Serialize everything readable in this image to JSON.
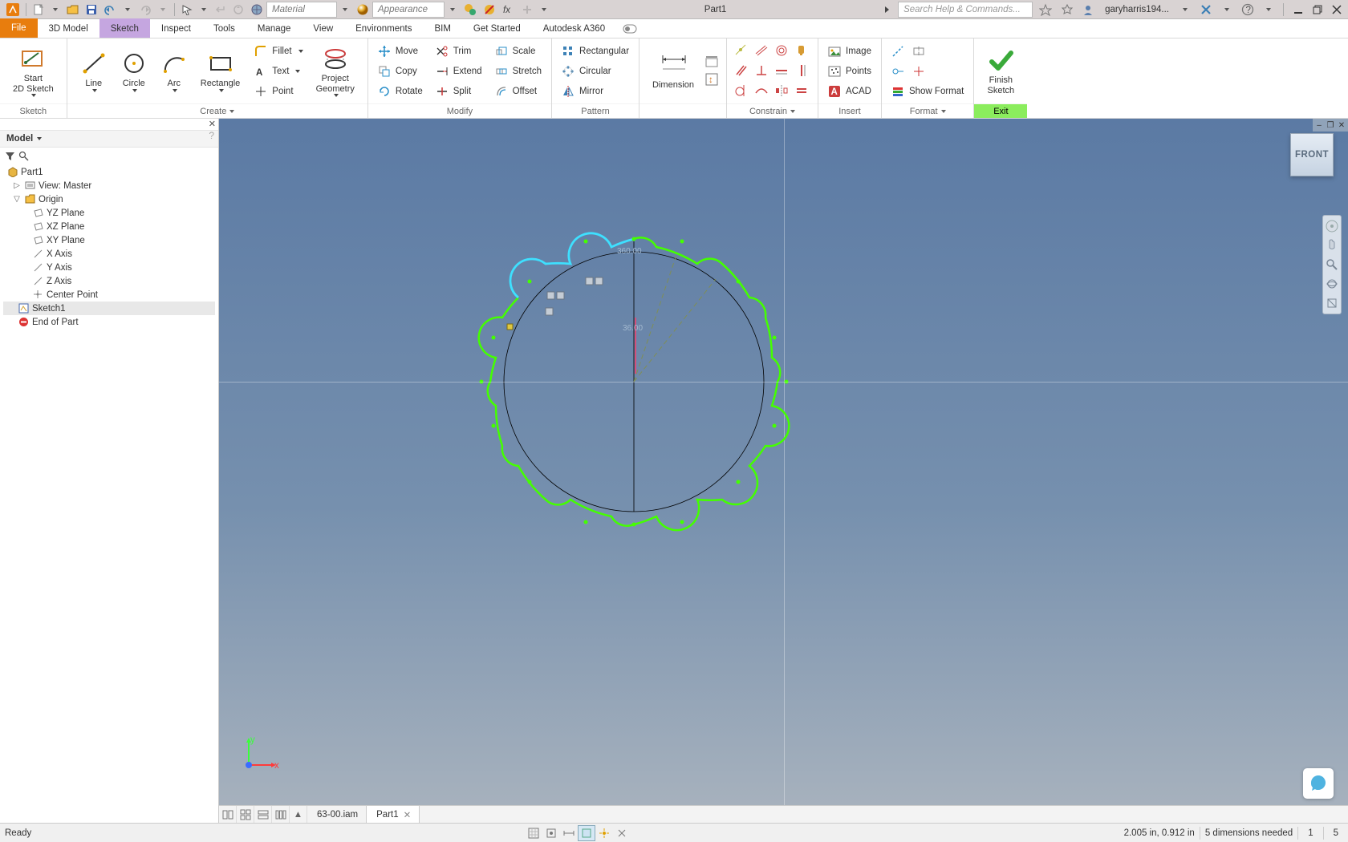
{
  "qat": {
    "material_label": "Material",
    "appearance_label": "Appearance",
    "doc_title": "Part1",
    "search_placeholder": "Search Help & Commands...",
    "username": "garyharris194..."
  },
  "tabs": {
    "file": "File",
    "items": [
      "3D Model",
      "Sketch",
      "Inspect",
      "Tools",
      "Manage",
      "View",
      "Environments",
      "BIM",
      "Get Started",
      "Autodesk A360"
    ],
    "active_index": 1
  },
  "ribbon": {
    "panels": {
      "sketch": {
        "label": "Sketch",
        "start": "Start\n2D Sketch"
      },
      "create": {
        "label": "Create",
        "line": "Line",
        "circle": "Circle",
        "arc": "Arc",
        "rect": "Rectangle",
        "fillet": "Fillet",
        "text": "Text",
        "point": "Point",
        "projgeom": "Project\nGeometry"
      },
      "modify": {
        "label": "Modify",
        "move": "Move",
        "copy": "Copy",
        "rotate": "Rotate",
        "trim": "Trim",
        "extend": "Extend",
        "split": "Split",
        "scale": "Scale",
        "stretch": "Stretch",
        "offset": "Offset"
      },
      "pattern": {
        "label": "Pattern",
        "rect": "Rectangular",
        "circ": "Circular",
        "mirror": "Mirror"
      },
      "dimension": {
        "label": "Dimension"
      },
      "constrain": {
        "label": "Constrain"
      },
      "insert": {
        "label": "Insert",
        "image": "Image",
        "points": "Points",
        "acad": "ACAD"
      },
      "format": {
        "label": "Format",
        "showfmt": "Show Format"
      },
      "exit": {
        "label": "Exit",
        "finish": "Finish\nSketch"
      }
    }
  },
  "browser": {
    "title": "Model",
    "root": "Part1",
    "view": "View: Master",
    "origin": "Origin",
    "planes": [
      "YZ Plane",
      "XZ Plane",
      "XY Plane"
    ],
    "axes": [
      "X Axis",
      "Y Axis",
      "Z Axis"
    ],
    "center": "Center Point",
    "sketch": "Sketch1",
    "end": "End of Part"
  },
  "viewcube": "FRONT",
  "sketch_dims": {
    "d1": "360.00",
    "d2": "36.00"
  },
  "triad": {
    "x": "x",
    "y": "y"
  },
  "doctabs": {
    "tab1": "63-00.iam",
    "tab2": "Part1",
    "active": 1
  },
  "status": {
    "ready": "Ready",
    "coords": "2.005 in, 0.912 in",
    "dims": "5 dimensions needed",
    "n1": "1",
    "n2": "5"
  }
}
